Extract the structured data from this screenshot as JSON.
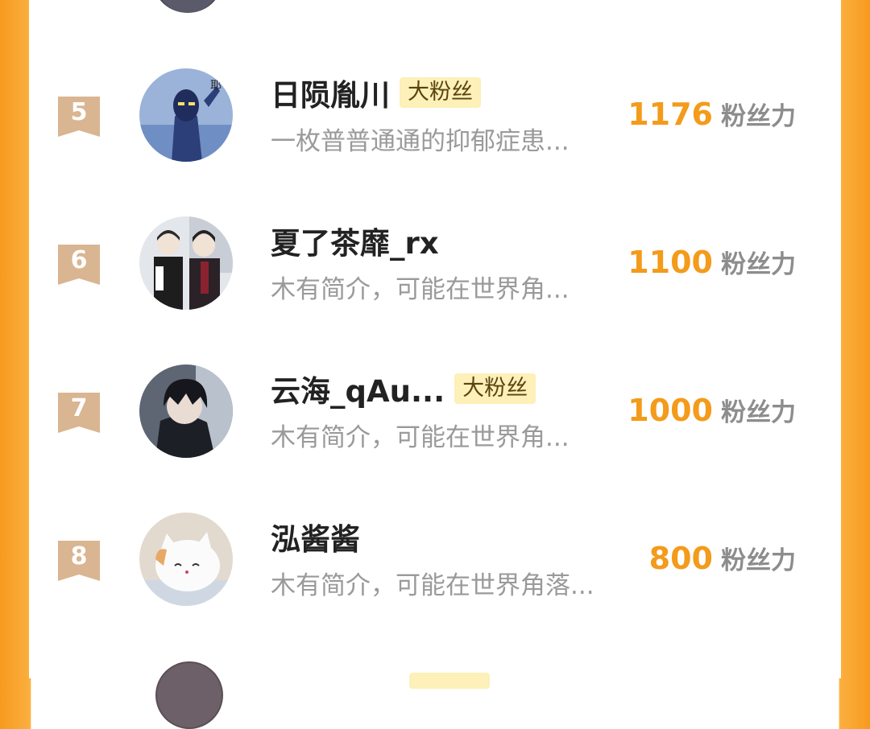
{
  "colors": {
    "accent": "#f39b1b",
    "rank_ribbon": "#d9b591",
    "badge_bg": "#fdf0b8",
    "side_orange": "#f79a1f"
  },
  "items": [
    {
      "rank": "5",
      "name": "日陨胤川",
      "badge": "大粉丝",
      "bio": "一枚普普通通的抑郁症患...",
      "score": "1176",
      "unit": "粉丝力",
      "avatar_icon": "ultraman-avatar-icon"
    },
    {
      "rank": "6",
      "name": "夏了茶靡_rx",
      "badge": "",
      "bio": "木有简介，可能在世界角...",
      "score": "1100",
      "unit": "粉丝力",
      "avatar_icon": "anime-couple-avatar-icon"
    },
    {
      "rank": "7",
      "name": "云海_qAu...",
      "badge": "大粉丝",
      "bio": "木有简介，可能在世界角...",
      "score": "1000",
      "unit": "粉丝力",
      "avatar_icon": "anime-boy-avatar-icon"
    },
    {
      "rank": "8",
      "name": "泓酱酱",
      "badge": "",
      "bio": "木有简介，可能在世界角落...",
      "score": "800",
      "unit": "粉丝力",
      "avatar_icon": "cat-avatar-icon"
    }
  ]
}
